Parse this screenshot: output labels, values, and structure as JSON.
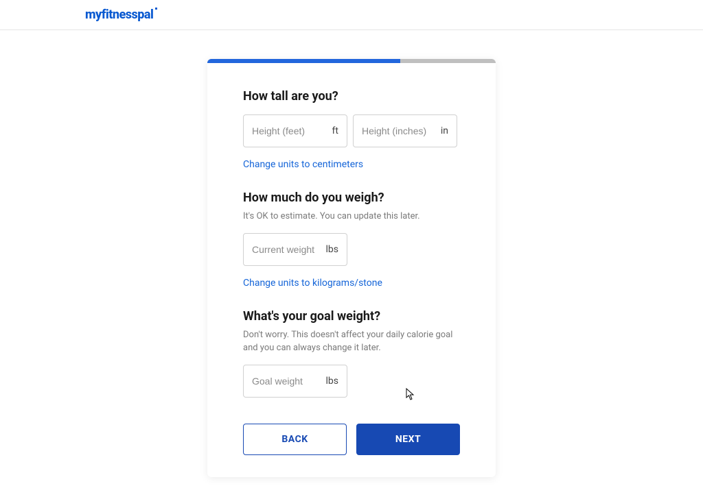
{
  "brand": "myfitnesspal",
  "progress_percent": 67,
  "height_section": {
    "question": "How tall are you?",
    "feet_placeholder": "Height (feet)",
    "feet_unit": "ft",
    "inches_placeholder": "Height (inches)",
    "inches_unit": "in",
    "units_link": "Change units to centimeters"
  },
  "weight_section": {
    "question": "How much do you weigh?",
    "subtext": "It's OK to estimate. You can update this later.",
    "placeholder": "Current weight",
    "unit": "lbs",
    "units_link": "Change units to kilograms/stone"
  },
  "goal_section": {
    "question": "What's your goal weight?",
    "subtext": "Don't worry. This doesn't affect your daily calorie goal and you can always change it later.",
    "placeholder": "Goal weight",
    "unit": "lbs"
  },
  "buttons": {
    "back": "BACK",
    "next": "NEXT"
  }
}
